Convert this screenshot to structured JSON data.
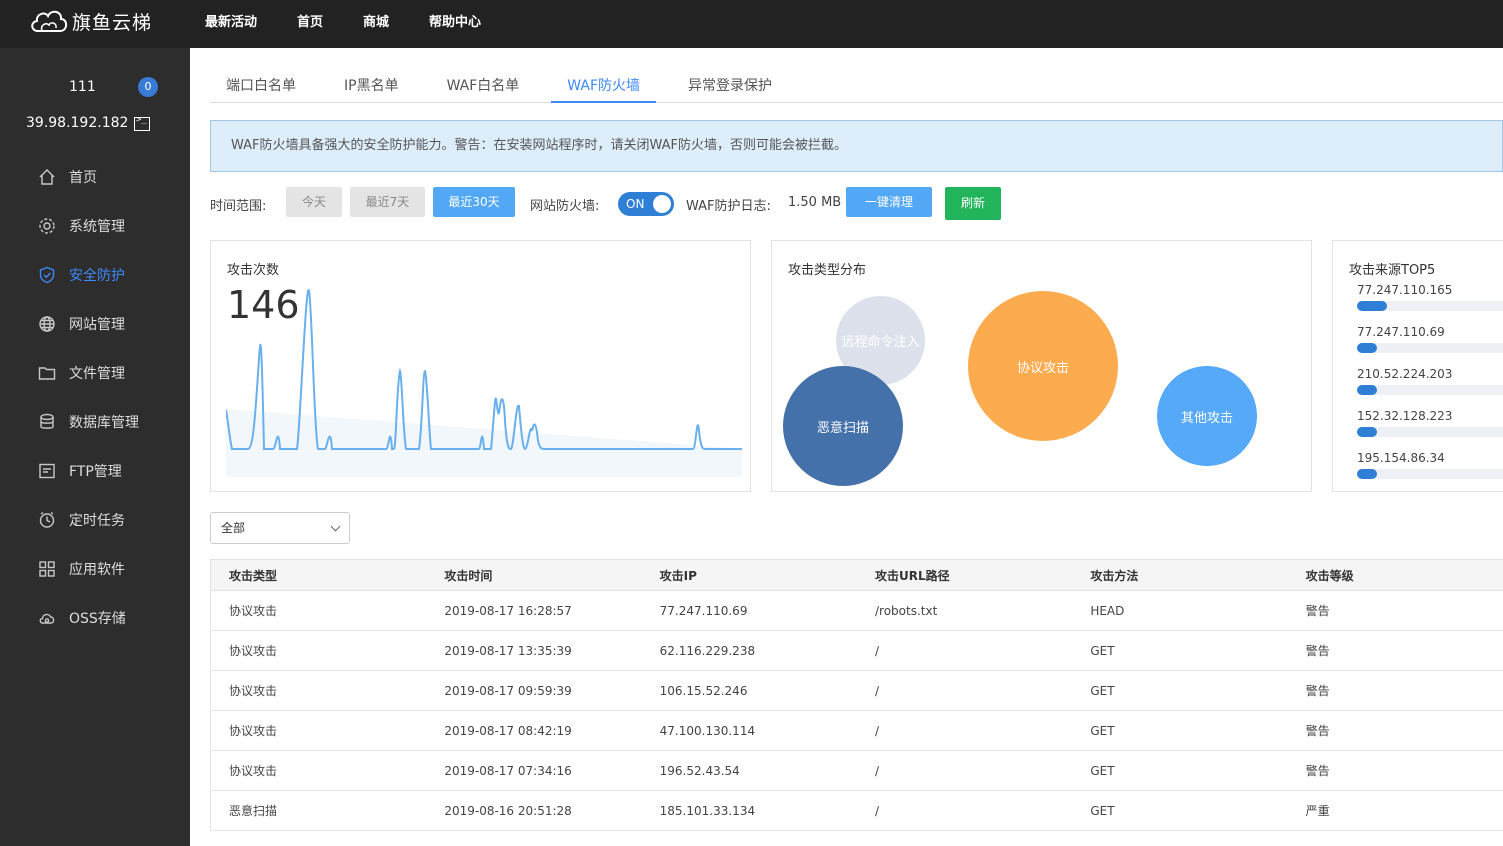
{
  "brand": {
    "name": "旗鱼云梯"
  },
  "topnav": [
    "最新活动",
    "首页",
    "商城",
    "帮助中心"
  ],
  "user": {
    "name": "111",
    "badge": "0",
    "ip": "39.98.192.182"
  },
  "sidebar": [
    {
      "label": "首页",
      "icon": "home-icon"
    },
    {
      "label": "系统管理",
      "icon": "gear-icon"
    },
    {
      "label": "安全防护",
      "icon": "shield-icon",
      "active": true
    },
    {
      "label": "网站管理",
      "icon": "globe-icon"
    },
    {
      "label": "文件管理",
      "icon": "folder-icon"
    },
    {
      "label": "数据库管理",
      "icon": "database-icon"
    },
    {
      "label": "FTP管理",
      "icon": "ftp-icon"
    },
    {
      "label": "定时任务",
      "icon": "clock-icon"
    },
    {
      "label": "应用软件",
      "icon": "apps-icon"
    },
    {
      "label": "OSS存储",
      "icon": "cloud-storage-icon"
    }
  ],
  "tabs": [
    "端口白名单",
    "IP黑名单",
    "WAF白名单",
    "WAF防火墙",
    "异常登录保护"
  ],
  "active_tab": "WAF防火墙",
  "notice": "WAF防火墙具备强大的安全防护能力。警告：在安装网站程序时，请关闭WAF防火墙，否则可能会被拦截。",
  "controls": {
    "range_label": "时间范围:",
    "range_today": "今天",
    "range_7": "最近7天",
    "range_30": "最近30天",
    "firewall_label": "网站防火墙:",
    "firewall_state": "ON",
    "log_label": "WAF防护日志:",
    "log_size": "1.50 MB",
    "clear_label": "一键清理",
    "refresh_label": "刷新"
  },
  "attack_count": {
    "title": "攻击次数",
    "value": "146"
  },
  "attack_types": {
    "title": "攻击类型分布",
    "items": [
      "远程命令注入",
      "协议攻击",
      "恶意扫描",
      "其他攻击"
    ]
  },
  "top5": {
    "title": "攻击来源TOP5",
    "items": [
      {
        "ip": "77.247.110.165",
        "share": 0.15
      },
      {
        "ip": "77.247.110.69",
        "share": 0.1
      },
      {
        "ip": "210.52.224.203",
        "share": 0.1
      },
      {
        "ip": "152.32.128.223",
        "share": 0.1
      },
      {
        "ip": "195.154.86.34",
        "share": 0.1
      }
    ]
  },
  "filter": {
    "selected": "全部"
  },
  "table": {
    "headers": [
      "攻击类型",
      "攻击时间",
      "攻击IP",
      "攻击URL路径",
      "攻击方法",
      "攻击等级"
    ],
    "rows": [
      [
        "协议攻击",
        "2019-08-17 16:28:57",
        "77.247.110.69",
        "/robots.txt",
        "HEAD",
        "警告"
      ],
      [
        "协议攻击",
        "2019-08-17 13:35:39",
        "62.116.229.238",
        "/",
        "GET",
        "警告"
      ],
      [
        "协议攻击",
        "2019-08-17 09:59:39",
        "106.15.52.246",
        "/",
        "GET",
        "警告"
      ],
      [
        "协议攻击",
        "2019-08-17 08:42:19",
        "47.100.130.114",
        "/",
        "GET",
        "警告"
      ],
      [
        "协议攻击",
        "2019-08-17 07:34:16",
        "196.52.43.54",
        "/",
        "GET",
        "警告"
      ],
      [
        "恶意扫描",
        "2019-08-16 20:51:28",
        "185.101.33.134",
        "/",
        "GET",
        "严重"
      ]
    ]
  },
  "colors": {
    "accent": "#3d8af7",
    "bubble_remote": "#dde1ec",
    "bubble_protocol": "#fdab4f",
    "bubble_scan": "#4471aa",
    "bubble_other": "#56a9f8"
  }
}
